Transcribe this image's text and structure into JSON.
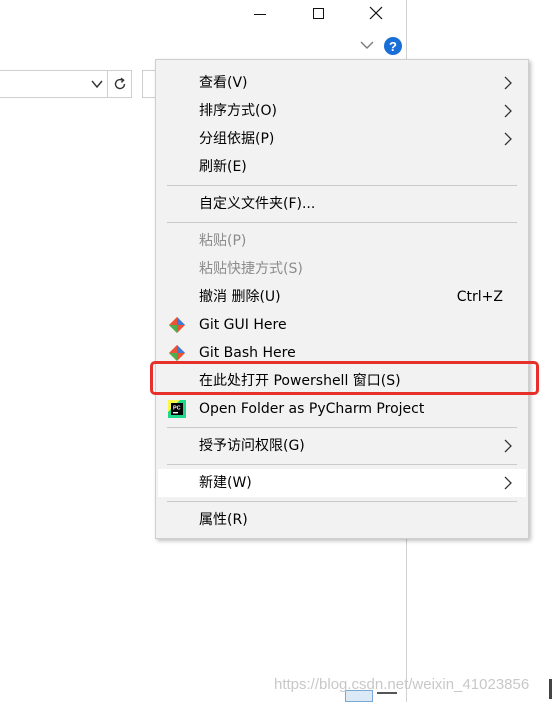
{
  "window": {
    "icons": {
      "minimize": "minimize-icon",
      "maximize": "maximize-icon",
      "close": "close-icon",
      "ribbon": "chevron-down-icon",
      "help": "help-icon",
      "refresh": "refresh-icon"
    },
    "help_glyph": "?"
  },
  "context_menu": {
    "items": {
      "view": {
        "label": "查看(V)"
      },
      "sort": {
        "label": "排序方式(O)"
      },
      "group": {
        "label": "分组依据(P)"
      },
      "refresh": {
        "label": "刷新(E)"
      },
      "customize": {
        "label": "自定义文件夹(F)..."
      },
      "paste": {
        "label": "粘贴(P)"
      },
      "paste_shortcut": {
        "label": "粘贴快捷方式(S)"
      },
      "undo_delete": {
        "label": "撤消 删除(U)",
        "shortcut": "Ctrl+Z"
      },
      "git_gui": {
        "label": "Git GUI Here"
      },
      "git_bash": {
        "label": "Git Bash Here"
      },
      "powershell": {
        "label": "在此处打开 Powershell 窗口(S)"
      },
      "pycharm": {
        "label": "Open Folder as PyCharm Project"
      },
      "grant_access": {
        "label": "授予访问权限(G)"
      },
      "new": {
        "label": "新建(W)"
      },
      "properties": {
        "label": "属性(R)"
      }
    }
  },
  "colors": {
    "highlight_box": "#e8302a",
    "menu_background": "#f2f2f2",
    "help_blue": "#1a6fd6"
  },
  "watermark": "https://blog.csdn.net/weixin_41023856"
}
